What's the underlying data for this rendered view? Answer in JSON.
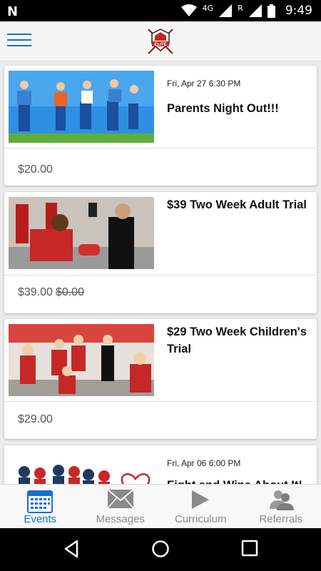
{
  "status_bar": {
    "network": "4G",
    "roaming": "R",
    "time": "9:49"
  },
  "header": {
    "logo_text": "ELITE"
  },
  "events": [
    {
      "date": "Fri, Apr 27 6:30 PM",
      "title": "Parents Night Out!!!",
      "price": "$20.00",
      "original_price": ""
    },
    {
      "date": "",
      "title": "$39 Two Week Adult Trial",
      "price": "$39.00",
      "original_price": "$0.00"
    },
    {
      "date": "",
      "title": "$29 Two Week Children's Trial",
      "price": "$29.00",
      "original_price": ""
    },
    {
      "date": "Fri, Apr 06 6:00 PM",
      "title": "Fight and Wine About It!",
      "price": "",
      "original_price": ""
    }
  ],
  "bottom_nav": {
    "items": [
      {
        "label": "Events",
        "icon": "calendar-icon",
        "active": true
      },
      {
        "label": "Messages",
        "icon": "envelope-icon",
        "active": false
      },
      {
        "label": "Curriculum",
        "icon": "play-icon",
        "active": false
      },
      {
        "label": "Referrals",
        "icon": "people-icon",
        "active": false
      }
    ]
  },
  "colors": {
    "accent": "#1a6fc9",
    "status_bar": "#000000",
    "card_bg": "#ffffff",
    "page_bg": "#ececec"
  }
}
